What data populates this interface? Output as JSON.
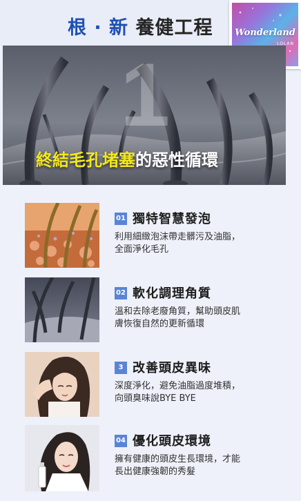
{
  "header": {
    "title_blue": "根 · 新",
    "title_dark": "養健工程",
    "logo_text": "Wonderland",
    "logo_sub": "LOLAN"
  },
  "hero": {
    "number": "1",
    "headline_highlight": "終結毛孔堵塞",
    "headline_rest": "的惡性循環"
  },
  "features": [
    {
      "badge": "01",
      "title": "獨特智慧發泡",
      "line1": "利用細緻泡沫帶走髒污及油脂，",
      "line2": "全面淨化毛孔"
    },
    {
      "badge": "02",
      "title": "軟化調理角質",
      "line1": "溫和去除老廢角質，幫助頭皮肌",
      "line2": "膚恢復自然的更新循環"
    },
    {
      "badge": "3",
      "title": "改善頭皮異味",
      "line1": "深度淨化，避免油脂過度堆積，",
      "line2": "向頭臭味說BYE BYE"
    },
    {
      "badge": "04",
      "title": "優化頭皮環境",
      "line1": "擁有健康的頭皮生長環境，才能",
      "line2": "長出健康強韌的秀髮"
    }
  ],
  "colors": {
    "accent": "#1f4fb4",
    "badge": "#5a84d6",
    "highlight": "#f4e81d"
  }
}
